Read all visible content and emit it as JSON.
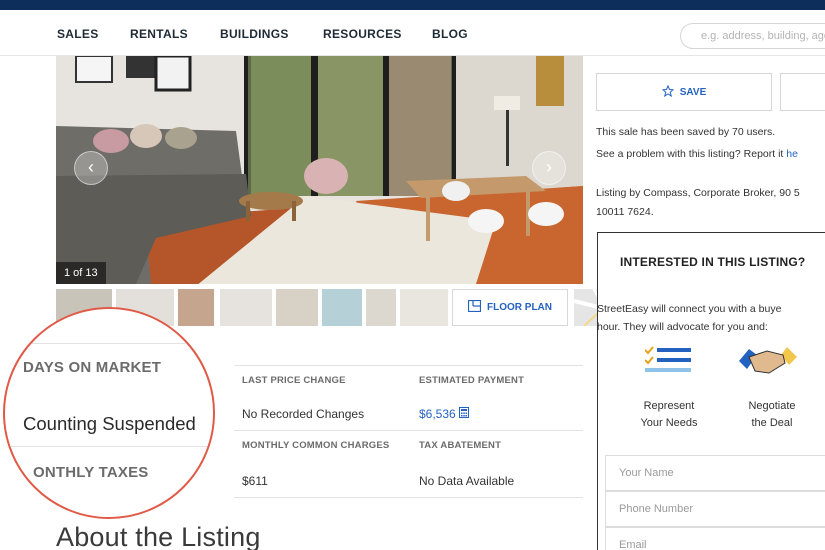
{
  "nav": {
    "items": [
      "SALES",
      "RENTALS",
      "BUILDINGS",
      "RESOURCES",
      "BLOG"
    ],
    "search_placeholder": "e.g. address, building, agent"
  },
  "gallery": {
    "counter": "1 of 13",
    "floor_plan_label": "FLOOR PLAN",
    "prev_icon": "chevron-left-icon",
    "next_icon": "chevron-right-icon"
  },
  "stats": {
    "days_on_market_label": "DAYS ON MARKET",
    "days_on_market_value": "Counting Suspended",
    "last_price_change_label": "LAST PRICE CHANGE",
    "last_price_change_value": "No Recorded Changes",
    "estimated_payment_label": "ESTIMATED PAYMENT",
    "estimated_payment_value": "$6,536",
    "monthly_taxes_label": "ONTHLY TAXES",
    "monthly_common_charges_label": "MONTHLY COMMON CHARGES",
    "monthly_common_charges_value": "$611",
    "tax_abatement_label": "TAX ABATEMENT",
    "tax_abatement_value": "No Data Available"
  },
  "about": {
    "heading": "About the Listing"
  },
  "sidebar": {
    "save_label": "SAVE",
    "saved_text": "This sale has been saved by 70 users.",
    "problem_text": "See a problem with this listing? Report it ",
    "problem_link": "he",
    "listing_by_line1": "Listing by Compass, Corporate Broker, 90 5",
    "listing_by_line2": "10011 7624."
  },
  "lead": {
    "title": "INTERESTED IN THIS LISTING?",
    "desc_line1": "StreetEasy will connect you with a buye",
    "desc_line2": "hour. They will advocate for you and:",
    "benefit1_line1": "Represent",
    "benefit1_line2": "Your Needs",
    "benefit2_line1": "Negotiate",
    "benefit2_line2": "the Deal",
    "name_placeholder": "Your Name",
    "phone_placeholder": "Phone Number",
    "email_placeholder": "Email"
  },
  "colors": {
    "brand_dark": "#0d2e5b",
    "link_blue": "#2462c1",
    "magnifier_ring": "#e05a47"
  }
}
